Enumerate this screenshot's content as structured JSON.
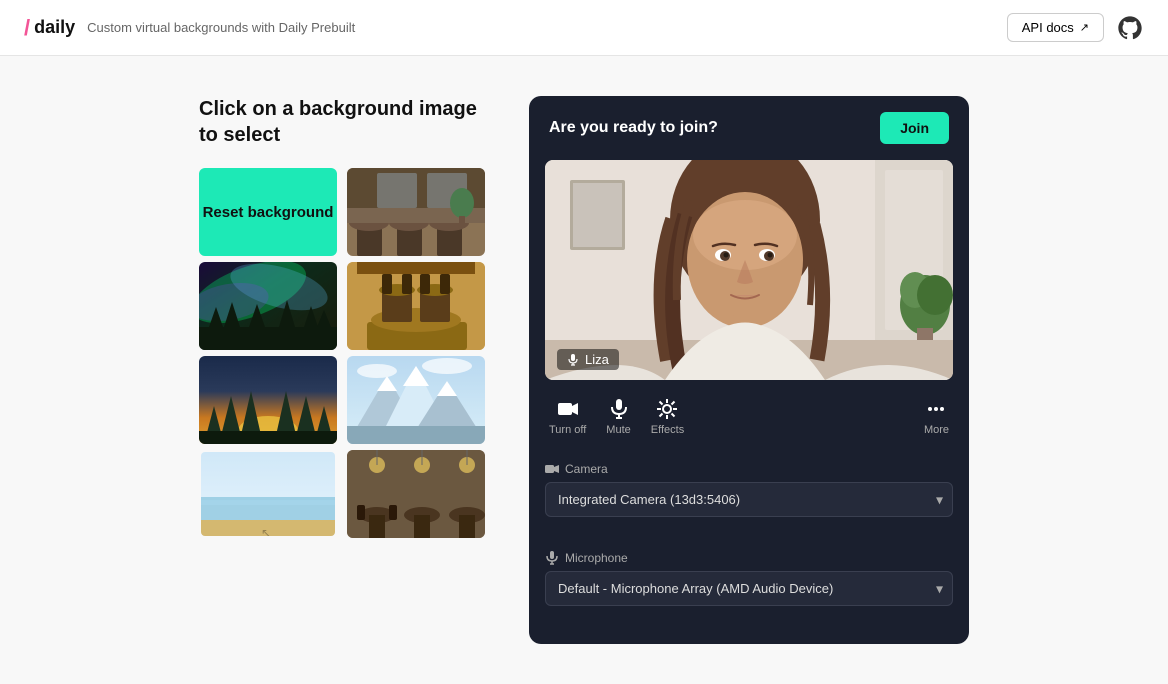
{
  "header": {
    "logo_slash": "/",
    "logo_text": "daily",
    "subtitle": "Custom virtual backgrounds with Daily Prebuilt",
    "api_docs_label": "API docs",
    "api_docs_icon": "↗"
  },
  "left_panel": {
    "title": "Click on a background image to select",
    "reset_label": "Reset background",
    "backgrounds": [
      {
        "id": "cafe",
        "alt": "Cafe with chairs"
      },
      {
        "id": "aurora",
        "alt": "Aurora borealis"
      },
      {
        "id": "dining",
        "alt": "Dining room"
      },
      {
        "id": "forest",
        "alt": "Forest at sunset"
      },
      {
        "id": "mountains",
        "alt": "Mountain snow peaks"
      },
      {
        "id": "beach",
        "alt": "Beach painting"
      },
      {
        "id": "restaurant",
        "alt": "Restaurant outdoor"
      }
    ]
  },
  "video_call": {
    "join_text": "Are you ready to join?",
    "join_btn_label": "Join",
    "user_name": "Liza",
    "controls": [
      {
        "id": "camera",
        "label": "Turn off",
        "icon": "📷"
      },
      {
        "id": "mute",
        "label": "Mute",
        "icon": "🎤"
      },
      {
        "id": "effects",
        "label": "Effects",
        "icon": "✨"
      },
      {
        "id": "more",
        "label": "More",
        "icon": "•••"
      }
    ],
    "camera_label": "Camera",
    "camera_options": [
      {
        "value": "13d3:5406",
        "label": "Integrated Camera (13d3:5406)"
      }
    ],
    "microphone_label": "Microphone",
    "microphone_options": [
      {
        "value": "amd_default",
        "label": "Default - Microphone Array (AMD Audio Device)"
      }
    ]
  },
  "colors": {
    "accent": "#1de9b6",
    "dark_bg": "#1a1f2e",
    "panel_bg": "#252a3a"
  }
}
